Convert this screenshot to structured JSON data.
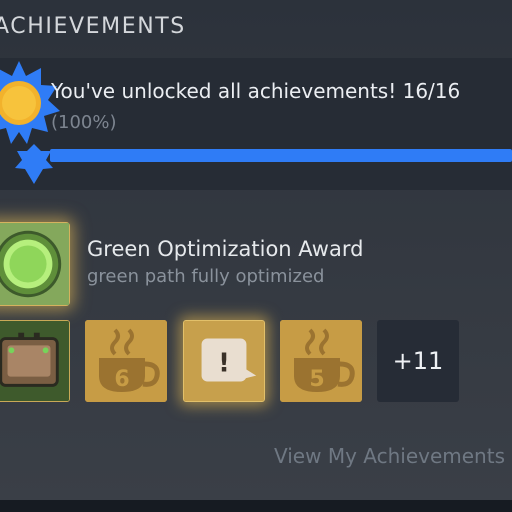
{
  "section": {
    "title": "ACHIEVEMENTS"
  },
  "progress": {
    "message": "You've unlocked all achievements! 16/16",
    "percent_label": "(100%)",
    "fraction": 1.0,
    "icon": "sun-badge-icon",
    "fill_color": "#2f7cf6"
  },
  "featured": {
    "name": "Green Optimization Award",
    "description": "green path fully optimized",
    "icon": "green-orb-icon"
  },
  "tiles": [
    {
      "icon": "robot-screen-icon"
    },
    {
      "icon": "coffee-cup-icon",
      "label": "6"
    },
    {
      "icon": "exclamation-speech-bubble-icon",
      "label": "!"
    },
    {
      "icon": "coffee-cup-icon",
      "label": "5"
    },
    {
      "icon": "more-achievements-tile",
      "label": "+11"
    }
  ],
  "footer": {
    "link": "View My Achievements"
  }
}
